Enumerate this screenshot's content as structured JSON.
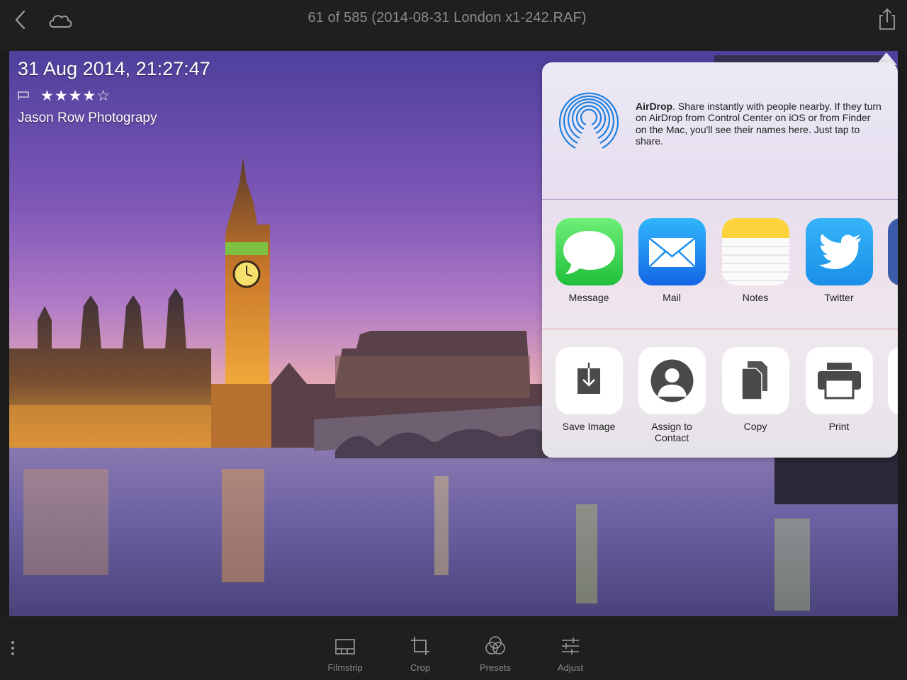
{
  "header": {
    "title": "61 of 585 (2014-08-31 London x1-242.RAF)"
  },
  "photo_overlay": {
    "datetime": "31 Aug 2014, 21:27:47",
    "rating_stars": "★★★★☆",
    "rating": 4,
    "owner": "Jason Row Photograpy"
  },
  "share_sheet": {
    "airdrop": {
      "title": "AirDrop",
      "description": ". Share instantly with people nearby. If they turn on AirDrop from Control Center on iOS or from Finder on the Mac, you'll see their names here. Just tap to share."
    },
    "apps": [
      {
        "label": "Message",
        "icon": "message-icon"
      },
      {
        "label": "Mail",
        "icon": "mail-icon"
      },
      {
        "label": "Notes",
        "icon": "notes-icon"
      },
      {
        "label": "Twitter",
        "icon": "twitter-icon"
      }
    ],
    "actions": [
      {
        "label": "Save Image",
        "icon": "save-image-icon"
      },
      {
        "label": "Assign to\nContact",
        "icon": "contact-icon"
      },
      {
        "label": "Copy",
        "icon": "copy-icon"
      },
      {
        "label": "Print",
        "icon": "print-icon"
      }
    ]
  },
  "toolbar": {
    "filmstrip": "Filmstrip",
    "crop": "Crop",
    "presets": "Presets",
    "adjust": "Adjust"
  },
  "colors": {
    "bar_bg": "#1f1f1f",
    "bar_text": "#8b8b8b",
    "airdrop_blue": "#1f7fe0",
    "message_green": "#2fcc47",
    "mail_blue": "#1d8ff2",
    "notes_yellow": "#fcd33a",
    "twitter_blue": "#1ea1f1"
  }
}
